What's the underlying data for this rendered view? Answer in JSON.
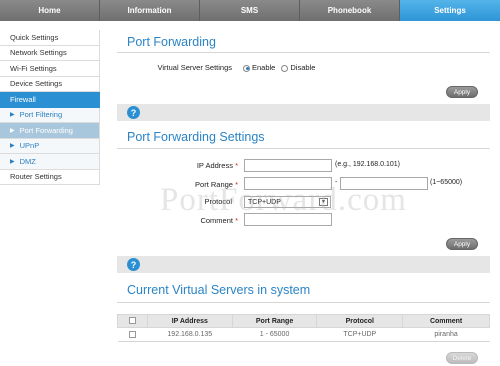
{
  "nav": {
    "tabs": [
      "Home",
      "Information",
      "SMS",
      "Phonebook",
      "Settings"
    ],
    "active": "Settings"
  },
  "sidebar": {
    "items": [
      {
        "label": "Quick Settings"
      },
      {
        "label": "Network Settings"
      },
      {
        "label": "Wi-Fi Settings"
      },
      {
        "label": "Device Settings"
      },
      {
        "label": "Firewall"
      },
      {
        "label": "Port Filtering"
      },
      {
        "label": "Port Forwarding"
      },
      {
        "label": "UPnP"
      },
      {
        "label": "DMZ"
      },
      {
        "label": "Router Settings"
      }
    ]
  },
  "port_forwarding": {
    "title": "Port Forwarding",
    "virtual_server_label": "Virtual Server Settings",
    "enable_label": "Enable",
    "disable_label": "Disable",
    "selected": "Enable",
    "apply_label": "Apply"
  },
  "settings": {
    "title": "Port Forwarding Settings",
    "ip_label": "IP Address",
    "ip_value": "",
    "ip_hint": "(e.g., 192.168.0.101)",
    "port_range_label": "Port Range",
    "port_from": "",
    "port_separator": "-",
    "port_to": "",
    "port_hint": "(1~65000)",
    "protocol_label": "Protocol",
    "protocol_value": "TCP+UDP",
    "comment_label": "Comment",
    "comment_value": "",
    "required_mark": "*",
    "apply_label": "Apply"
  },
  "help_icon": "question-icon",
  "servers": {
    "title": "Current Virtual Servers in system",
    "columns": [
      "IP Address",
      "Port Range",
      "Protocol",
      "Comment"
    ],
    "rows": [
      {
        "ip": "192.168.0.135",
        "port_range": "1 - 65000",
        "protocol": "TCP+UDP",
        "comment": "piranha"
      }
    ],
    "delete_label": "Delete"
  },
  "watermark": "PortForward.com",
  "colors": {
    "accent": "#2b8fd3",
    "title": "#2b84c6",
    "nav_bg": "#7a7a7a"
  }
}
